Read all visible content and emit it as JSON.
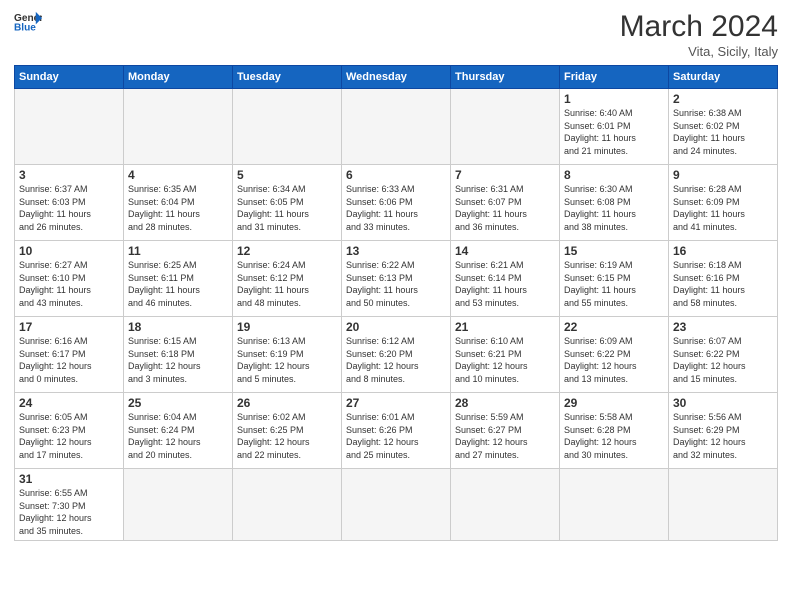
{
  "header": {
    "logo_general": "General",
    "logo_blue": "Blue",
    "month_title": "March 2024",
    "subtitle": "Vita, Sicily, Italy"
  },
  "weekdays": [
    "Sunday",
    "Monday",
    "Tuesday",
    "Wednesday",
    "Thursday",
    "Friday",
    "Saturday"
  ],
  "weeks": [
    [
      {
        "day": "",
        "info": ""
      },
      {
        "day": "",
        "info": ""
      },
      {
        "day": "",
        "info": ""
      },
      {
        "day": "",
        "info": ""
      },
      {
        "day": "",
        "info": ""
      },
      {
        "day": "1",
        "info": "Sunrise: 6:40 AM\nSunset: 6:01 PM\nDaylight: 11 hours\nand 21 minutes."
      },
      {
        "day": "2",
        "info": "Sunrise: 6:38 AM\nSunset: 6:02 PM\nDaylight: 11 hours\nand 24 minutes."
      }
    ],
    [
      {
        "day": "3",
        "info": "Sunrise: 6:37 AM\nSunset: 6:03 PM\nDaylight: 11 hours\nand 26 minutes."
      },
      {
        "day": "4",
        "info": "Sunrise: 6:35 AM\nSunset: 6:04 PM\nDaylight: 11 hours\nand 28 minutes."
      },
      {
        "day": "5",
        "info": "Sunrise: 6:34 AM\nSunset: 6:05 PM\nDaylight: 11 hours\nand 31 minutes."
      },
      {
        "day": "6",
        "info": "Sunrise: 6:33 AM\nSunset: 6:06 PM\nDaylight: 11 hours\nand 33 minutes."
      },
      {
        "day": "7",
        "info": "Sunrise: 6:31 AM\nSunset: 6:07 PM\nDaylight: 11 hours\nand 36 minutes."
      },
      {
        "day": "8",
        "info": "Sunrise: 6:30 AM\nSunset: 6:08 PM\nDaylight: 11 hours\nand 38 minutes."
      },
      {
        "day": "9",
        "info": "Sunrise: 6:28 AM\nSunset: 6:09 PM\nDaylight: 11 hours\nand 41 minutes."
      }
    ],
    [
      {
        "day": "10",
        "info": "Sunrise: 6:27 AM\nSunset: 6:10 PM\nDaylight: 11 hours\nand 43 minutes."
      },
      {
        "day": "11",
        "info": "Sunrise: 6:25 AM\nSunset: 6:11 PM\nDaylight: 11 hours\nand 46 minutes."
      },
      {
        "day": "12",
        "info": "Sunrise: 6:24 AM\nSunset: 6:12 PM\nDaylight: 11 hours\nand 48 minutes."
      },
      {
        "day": "13",
        "info": "Sunrise: 6:22 AM\nSunset: 6:13 PM\nDaylight: 11 hours\nand 50 minutes."
      },
      {
        "day": "14",
        "info": "Sunrise: 6:21 AM\nSunset: 6:14 PM\nDaylight: 11 hours\nand 53 minutes."
      },
      {
        "day": "15",
        "info": "Sunrise: 6:19 AM\nSunset: 6:15 PM\nDaylight: 11 hours\nand 55 minutes."
      },
      {
        "day": "16",
        "info": "Sunrise: 6:18 AM\nSunset: 6:16 PM\nDaylight: 11 hours\nand 58 minutes."
      }
    ],
    [
      {
        "day": "17",
        "info": "Sunrise: 6:16 AM\nSunset: 6:17 PM\nDaylight: 12 hours\nand 0 minutes."
      },
      {
        "day": "18",
        "info": "Sunrise: 6:15 AM\nSunset: 6:18 PM\nDaylight: 12 hours\nand 3 minutes."
      },
      {
        "day": "19",
        "info": "Sunrise: 6:13 AM\nSunset: 6:19 PM\nDaylight: 12 hours\nand 5 minutes."
      },
      {
        "day": "20",
        "info": "Sunrise: 6:12 AM\nSunset: 6:20 PM\nDaylight: 12 hours\nand 8 minutes."
      },
      {
        "day": "21",
        "info": "Sunrise: 6:10 AM\nSunset: 6:21 PM\nDaylight: 12 hours\nand 10 minutes."
      },
      {
        "day": "22",
        "info": "Sunrise: 6:09 AM\nSunset: 6:22 PM\nDaylight: 12 hours\nand 13 minutes."
      },
      {
        "day": "23",
        "info": "Sunrise: 6:07 AM\nSunset: 6:22 PM\nDaylight: 12 hours\nand 15 minutes."
      }
    ],
    [
      {
        "day": "24",
        "info": "Sunrise: 6:05 AM\nSunset: 6:23 PM\nDaylight: 12 hours\nand 17 minutes."
      },
      {
        "day": "25",
        "info": "Sunrise: 6:04 AM\nSunset: 6:24 PM\nDaylight: 12 hours\nand 20 minutes."
      },
      {
        "day": "26",
        "info": "Sunrise: 6:02 AM\nSunset: 6:25 PM\nDaylight: 12 hours\nand 22 minutes."
      },
      {
        "day": "27",
        "info": "Sunrise: 6:01 AM\nSunset: 6:26 PM\nDaylight: 12 hours\nand 25 minutes."
      },
      {
        "day": "28",
        "info": "Sunrise: 5:59 AM\nSunset: 6:27 PM\nDaylight: 12 hours\nand 27 minutes."
      },
      {
        "day": "29",
        "info": "Sunrise: 5:58 AM\nSunset: 6:28 PM\nDaylight: 12 hours\nand 30 minutes."
      },
      {
        "day": "30",
        "info": "Sunrise: 5:56 AM\nSunset: 6:29 PM\nDaylight: 12 hours\nand 32 minutes."
      }
    ],
    [
      {
        "day": "31",
        "info": "Sunrise: 6:55 AM\nSunset: 7:30 PM\nDaylight: 12 hours\nand 35 minutes."
      },
      {
        "day": "",
        "info": ""
      },
      {
        "day": "",
        "info": ""
      },
      {
        "day": "",
        "info": ""
      },
      {
        "day": "",
        "info": ""
      },
      {
        "day": "",
        "info": ""
      },
      {
        "day": "",
        "info": ""
      }
    ]
  ]
}
